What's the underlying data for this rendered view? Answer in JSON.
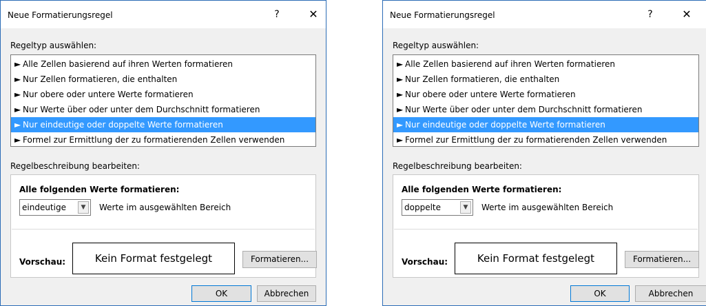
{
  "dialogs": [
    {
      "title": "Neue Formatierungsregel",
      "help_label": "?",
      "close_label": "✕",
      "rule_type_label": "Regeltyp auswählen:",
      "rules": [
        "Alle Zellen basierend auf ihren Werten formatieren",
        "Nur Zellen formatieren, die enthalten",
        "Nur obere oder untere Werte formatieren",
        "Nur Werte über oder unter dem Durchschnitt formatieren",
        "Nur eindeutige oder doppelte Werte formatieren",
        "Formel zur Ermittlung der zu formatierenden Zellen verwenden"
      ],
      "selected_rule_index": 4,
      "description_label": "Regelbeschreibung bearbeiten:",
      "format_all_label": "Alle folgenden Werte formatieren:",
      "select_value": "eindeutige",
      "range_text": "Werte im ausgewählten Bereich",
      "preview_label": "Vorschau:",
      "preview_text": "Kein Format festgelegt",
      "format_button": "Formatieren...",
      "ok_button": "OK",
      "cancel_button": "Abbrechen"
    },
    {
      "title": "Neue Formatierungsregel",
      "help_label": "?",
      "close_label": "✕",
      "rule_type_label": "Regeltyp auswählen:",
      "rules": [
        "Alle Zellen basierend auf ihren Werten formatieren",
        "Nur Zellen formatieren, die enthalten",
        "Nur obere oder untere Werte formatieren",
        "Nur Werte über oder unter dem Durchschnitt formatieren",
        "Nur eindeutige oder doppelte Werte formatieren",
        "Formel zur Ermittlung der zu formatierenden Zellen verwenden"
      ],
      "selected_rule_index": 4,
      "description_label": "Regelbeschreibung bearbeiten:",
      "format_all_label": "Alle folgenden Werte formatieren:",
      "select_value": "doppelte",
      "range_text": "Werte im ausgewählten Bereich",
      "preview_label": "Vorschau:",
      "preview_text": "Kein Format festgelegt",
      "format_button": "Formatieren...",
      "ok_button": "OK",
      "cancel_button": "Abbrechen"
    }
  ],
  "colors": {
    "selection": "#3399ff",
    "dialog_border": "#2b6cb6",
    "dialog_background": "#f0f0f0"
  }
}
